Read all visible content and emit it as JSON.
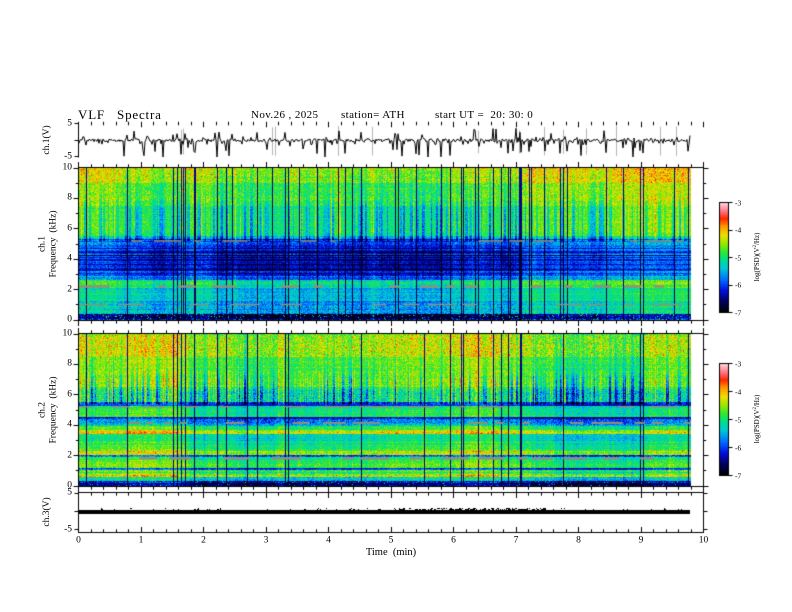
{
  "title": {
    "main": "VLF  Spectra",
    "date": "Nov.26 , 2025",
    "station": "station= ATH",
    "start_ut": "start UT =  20: 30: 0"
  },
  "axes": {
    "ch1v": "ch.1(V)",
    "ch1f": "ch.1\nFrequency  (kHz)",
    "ch2f": "ch.2\nFrequency  (kHz)",
    "ch3v": "ch.3(V)",
    "time_label": "Time  (min)",
    "x_ticks": [
      "0",
      "1",
      "2",
      "3",
      "4",
      "5",
      "6",
      "7",
      "8",
      "9",
      "10"
    ],
    "freq_ticks": [
      "0",
      "2",
      "4",
      "6",
      "8",
      "10"
    ],
    "volt_ticks": [
      "5",
      "-5"
    ]
  },
  "colorbar": {
    "ticks": [
      "-3",
      "-4",
      "-5",
      "-6",
      "-7"
    ],
    "label_pre": "log(PSD)(V",
    "label_sup": "2",
    "label_post": "/Hz)"
  },
  "colormap": [
    [
      0,
      "#000000"
    ],
    [
      0.1,
      "#000060"
    ],
    [
      0.2,
      "#0010e0"
    ],
    [
      0.3,
      "#0070ff"
    ],
    [
      0.4,
      "#00c8d8"
    ],
    [
      0.48,
      "#00e088"
    ],
    [
      0.55,
      "#30e830"
    ],
    [
      0.63,
      "#a0e800"
    ],
    [
      0.7,
      "#f0e000"
    ],
    [
      0.78,
      "#ff9800"
    ],
    [
      0.85,
      "#ff2800"
    ],
    [
      0.92,
      "#ff7888"
    ],
    [
      1,
      "#ffdde4"
    ]
  ],
  "gray_color": "#8f8f7f",
  "chart_data": [
    {
      "type": "line",
      "panel": "ch.1(V)",
      "xlim": [
        0,
        10
      ],
      "ylim": [
        -5,
        5
      ],
      "x_unit": "min",
      "description": "broadband VLF waveform near 0 V with impulsive spikes",
      "data_end_min": 9.8,
      "gen": {
        "seed": 21,
        "noise_amp": 0.5,
        "n_events": 95
      }
    },
    {
      "type": "heatmap",
      "panel": "ch.1 Frequency (kHz)",
      "xlim": [
        0,
        10
      ],
      "ylim": [
        0,
        10
      ],
      "value_label": "log(PSD)(V2/Hz)",
      "value_range": [
        -7,
        -3
      ],
      "description": "spectrogram: yellow 8-10 kHz, green 5-8 kHz with blue vertical streaks, dark blue 3-5 kHz band, cyan 1-2.5 kHz, black band below 0.5 kHz, gray interference lines at 5.2/2.2/1.0 kHz",
      "gen": {
        "seed": 101,
        "bands": [
          [
            9.85,
            10.01,
            0.7,
            0.1,
            0.02,
            0.1,
            0.18
          ],
          [
            9.0,
            9.85,
            0.67,
            0.09,
            0.02,
            0.06,
            0.16
          ],
          [
            7.5,
            9.0,
            0.61,
            0.09,
            0.02,
            0.02,
            0.14
          ],
          [
            5.5,
            7.5,
            0.56,
            0.07,
            0.02,
            0,
            0
          ],
          [
            5.3,
            5.5,
            0.44,
            0.07,
            0.03,
            0,
            0
          ],
          [
            4.9,
            5.3,
            0.3,
            0.08,
            0.06,
            0,
            0
          ],
          [
            3.0,
            4.9,
            0.24,
            0.07,
            0.1,
            0,
            0
          ],
          [
            2.62,
            3.0,
            0.29,
            0.08,
            0.09,
            0,
            0
          ],
          [
            2.1,
            2.62,
            0.52,
            0.09,
            0.05,
            0,
            0
          ],
          [
            1.25,
            2.1,
            0.46,
            0.07,
            0.04,
            0,
            0
          ],
          [
            0.95,
            1.25,
            0.42,
            0.08,
            0.05,
            0,
            0
          ],
          [
            0.55,
            0.95,
            0.42,
            0.09,
            0.06,
            0,
            0
          ],
          [
            0.42,
            0.55,
            0.4,
            0.1,
            0.05,
            0,
            0
          ],
          [
            0.12,
            0.42,
            0.08,
            0.09,
            0.06,
            0.08,
            0.4
          ],
          [
            -0.01,
            0.12,
            0.16,
            0.14,
            0.06,
            0.04,
            0.3
          ]
        ],
        "grays": [
          [
            5.2,
            1.5
          ],
          [
            2.2,
            2.5
          ],
          [
            1.02,
            1.5
          ]
        ],
        "colfx": {
          "fmin": 5.2,
          "blueN": 150,
          "blueS": [
            0.08,
            0.22
          ],
          "brightN": 60,
          "brightS": [
            0.05,
            0.16
          ],
          "blackExtra": 5,
          "evMod": 2,
          "bHi": 7.0,
          "bTail": 0.33,
          "bDec": 0.45
        }
      }
    },
    {
      "type": "heatmap",
      "panel": "ch.2 Frequency (kHz)",
      "xlim": [
        0,
        10
      ],
      "ylim": [
        0,
        10
      ],
      "value_label": "log(PSD)(V2/Hz)",
      "value_range": [
        -7,
        -3
      ],
      "description": "spectrogram: green/yellow 6-10 kHz with yellow streaks, horizontal interference lines below 5.5 kHz, orange line ~3.6 kHz, yellow band ~2.2 kHz, black band below 0.3 kHz",
      "gen": {
        "seed": 202,
        "bands": [
          [
            9.9,
            10.01,
            0.62,
            0.12,
            0.02,
            0.05,
            0.15
          ],
          [
            8.5,
            9.9,
            0.65,
            0.1,
            0.02,
            0.1,
            0.15
          ],
          [
            6.5,
            8.5,
            0.58,
            0.08,
            0.02,
            0.01,
            0.12
          ],
          [
            5.55,
            6.35,
            0.46,
            0.12,
            0.03,
            0,
            0
          ],
          [
            6.35,
            6.5,
            0.52,
            0.08,
            0.03,
            0,
            0
          ],
          [
            5.28,
            5.55,
            0.2,
            0.08,
            0.06,
            0,
            0
          ],
          [
            4.55,
            5.28,
            0.5,
            0.07,
            0.04,
            0,
            0
          ],
          [
            4.38,
            4.55,
            0.2,
            0.08,
            0.04,
            0,
            0
          ],
          [
            3.95,
            4.38,
            0.37,
            0.1,
            0.07,
            0,
            0
          ],
          [
            3.7,
            3.95,
            0.55,
            0.08,
            0.04,
            0,
            0
          ],
          [
            3.42,
            3.7,
            0.7,
            0.09,
            0.05,
            0.06,
            0.12
          ],
          [
            2.95,
            3.42,
            0.47,
            0.07,
            0.05,
            0,
            0
          ],
          [
            2.42,
            2.95,
            0.52,
            0.07,
            0.05,
            0,
            0
          ],
          [
            2.3,
            2.42,
            0.6,
            0.08,
            0.04,
            0,
            0
          ],
          [
            2.02,
            2.3,
            0.68,
            0.09,
            0.06,
            0.04,
            0.1
          ],
          [
            1.92,
            2.02,
            0.3,
            0.1,
            0.06,
            0,
            0
          ],
          [
            1.55,
            1.92,
            0.52,
            0.07,
            0.05,
            0,
            0
          ],
          [
            1.18,
            1.55,
            0.55,
            0.08,
            0.05,
            0,
            0
          ],
          [
            1.02,
            1.18,
            0.28,
            0.08,
            0.05,
            0,
            0
          ],
          [
            0.72,
            1.02,
            0.55,
            0.1,
            0.06,
            0,
            0
          ],
          [
            0.58,
            0.72,
            0.64,
            0.12,
            0.05,
            0.08,
            0.15
          ],
          [
            0.3,
            0.58,
            0.44,
            0.08,
            0.05,
            0,
            0
          ],
          [
            0.18,
            0.3,
            0.18,
            0.12,
            0.06,
            0.05,
            0.3
          ],
          [
            -0.01,
            0.18,
            0.08,
            0.08,
            0.05,
            0.05,
            0.3
          ]
        ],
        "grays": [
          [
            5.22,
            1.5
          ],
          [
            4.15,
            2
          ],
          [
            1.82,
            2.5
          ]
        ],
        "colfx": {
          "fmin": 5.4,
          "blueN": 110,
          "blueS": [
            0.1,
            0.28
          ],
          "brightN": 230,
          "brightS": [
            0.05,
            0.17
          ],
          "blackExtra": 4,
          "evMod": 4,
          "bHi": 6.9,
          "bTail": 0.3,
          "bDec": 0.9
        }
      }
    },
    {
      "type": "line",
      "panel": "ch.3(V)",
      "xlim": [
        0,
        10
      ],
      "ylim": [
        -5,
        5
      ],
      "description": "constant ~0 V thick flat trace",
      "gen": {
        "seed": 33
      }
    }
  ]
}
